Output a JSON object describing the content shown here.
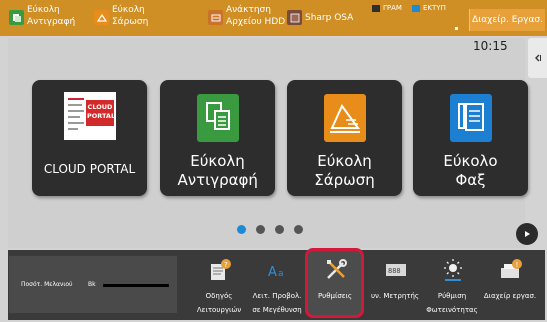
{
  "topbar": {
    "shortcuts": [
      {
        "label": "Εύκολη Αντιγραφή",
        "icon": "copy-icon"
      },
      {
        "label": "Εύκολη Σάρωση",
        "icon": "scan-icon"
      },
      {
        "label": "Ανάκτηση Αρχείου HDD",
        "icon": "hdd-retrieve-icon"
      },
      {
        "label": "Sharp OSA",
        "icon": "sharp-osa-icon"
      }
    ],
    "indicators": [
      {
        "label": "ΓΡΑΜ",
        "color": "#1c8ad7"
      },
      {
        "label": "ΕΚΤΥΠ",
        "color": "#1c8ad7"
      }
    ],
    "jobs_button": "Διαχείρ. Εργασ."
  },
  "clock": "10:15",
  "tiles": [
    {
      "label": "CLOUD PORTAL",
      "logo_text": "CLOUD PORTAL",
      "icon": "cloud-portal-icon"
    },
    {
      "label": "Εύκολη Αντιγραφή",
      "icon": "easy-copy-icon",
      "color": "#3a9a3f"
    },
    {
      "label": "Εύκολη Σάρωση",
      "icon": "easy-scan-icon",
      "color": "#e88c1a"
    },
    {
      "label": "Εύκολο Φαξ",
      "icon": "easy-fax-icon",
      "color": "#1c7fd2"
    }
  ],
  "pagination": {
    "total": 4,
    "current": 1
  },
  "dock": {
    "toner": {
      "label": "Ποσότ. Μελανιού",
      "color_code": "Bk"
    },
    "items": [
      {
        "label_line1": "Οδηγός",
        "label_line2": "Λειτουργιών",
        "icon": "operation-guide-icon"
      },
      {
        "label_line1": "Λειτ. Προβολ.",
        "label_line2": "σε Μεγέθυνση",
        "icon": "enlarge-display-icon"
      },
      {
        "label_line1": "Ρυθμίσεις",
        "label_line2": "",
        "icon": "settings-icon"
      },
      {
        "label_line1": "υν. Μετρητής",
        "label_line2": "",
        "icon": "total-count-icon"
      },
      {
        "label_line1": "Ρύθμιση",
        "label_line2": "Φωτεινότητας",
        "icon": "brightness-icon"
      },
      {
        "label_line1": "Διαχείρ εργασ.",
        "label_line2": "",
        "icon": "job-status-icon"
      }
    ]
  },
  "highlight_color": "#d4183a"
}
